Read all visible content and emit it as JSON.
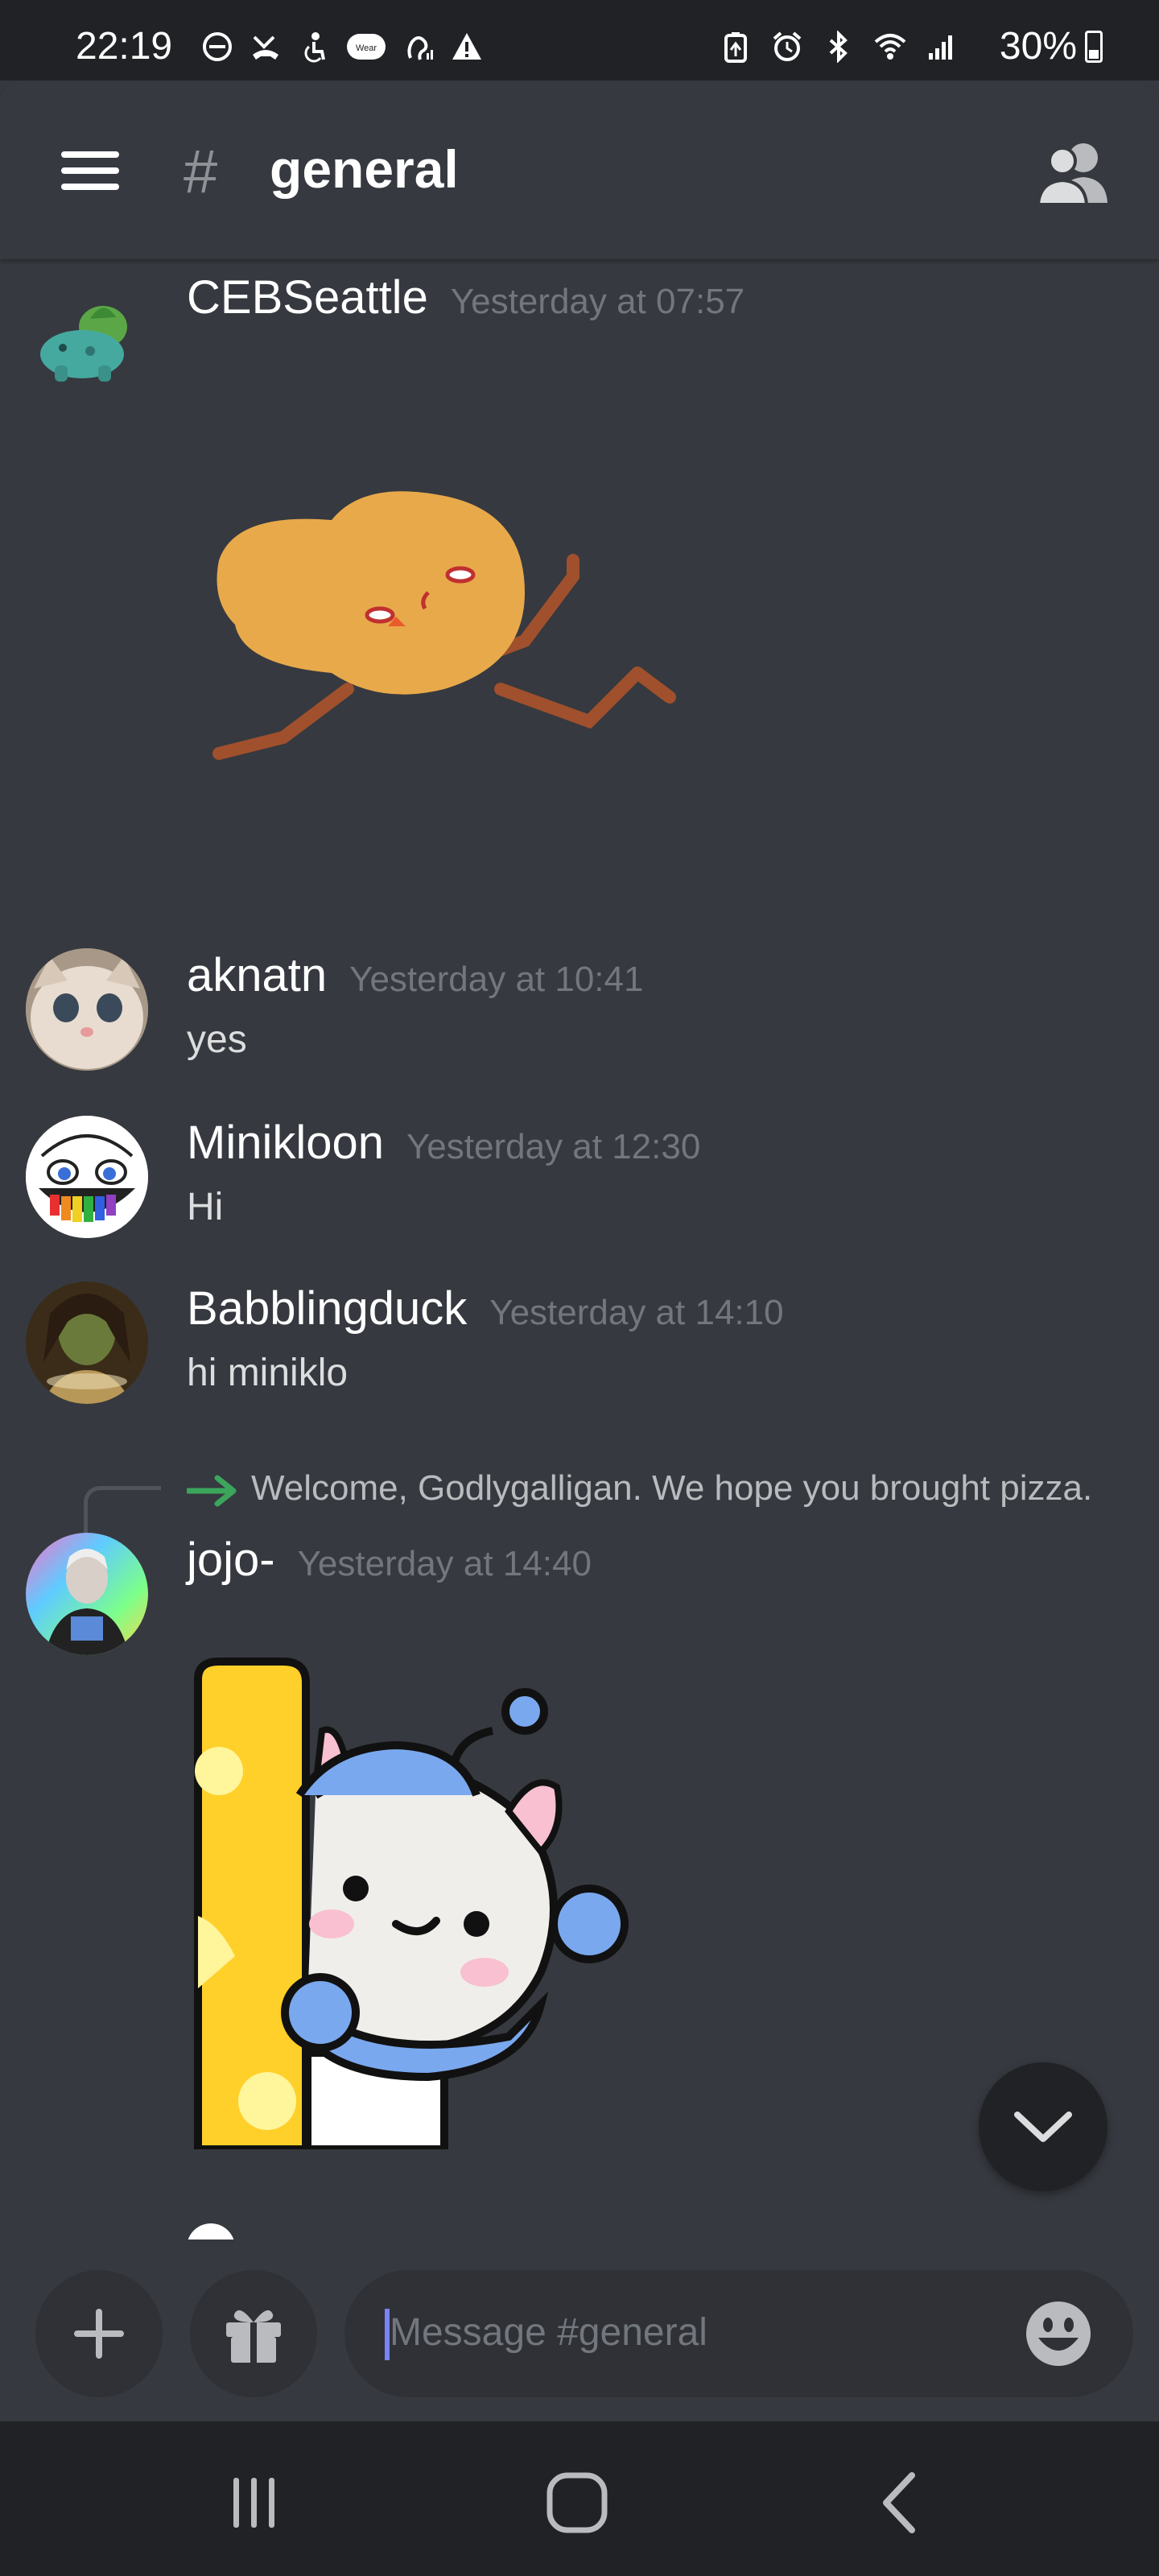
{
  "status_bar": {
    "time": "22:19",
    "battery": "30%",
    "battery_level": 0.3,
    "left_icons": [
      "dnd-icon",
      "missed-call-icon",
      "accessibility-icon",
      "wear-icon",
      "hearing-icon",
      "warning-icon"
    ],
    "right_icons": [
      "battery-saver-icon",
      "alarm-icon",
      "bluetooth-icon",
      "wifi-icon",
      "signal-icon"
    ]
  },
  "header": {
    "hash_symbol": "#",
    "channel_name": "general"
  },
  "messages": [
    {
      "username": "CEBSeattle",
      "timestamp": "Yesterday at 07:57",
      "text": "",
      "avatar": "bulbasaur"
    },
    {
      "username": "aknatn",
      "timestamp": "Yesterday at 10:41",
      "text": "yes",
      "avatar": "cat"
    },
    {
      "username": "Minikloon",
      "timestamp": "Yesterday at 12:30",
      "text": "Hi",
      "avatar": "trollface"
    },
    {
      "username": "Babblingduck",
      "timestamp": "Yesterday at 14:10",
      "text": "hi miniklo",
      "avatar": "portrait"
    },
    {
      "username": "jojo-",
      "timestamp": "Yesterday at 14:40",
      "text": "",
      "avatar": "colorful"
    }
  ],
  "system_message": {
    "text": "Welcome, Godlygalligan. We hope you brought pizza."
  },
  "composer": {
    "placeholder": "Message #general"
  },
  "colors": {
    "background": "#36393f",
    "dark": "#202225",
    "input": "#2f3136",
    "accent_green": "#3ba55c",
    "timestamp": "#72767d"
  }
}
